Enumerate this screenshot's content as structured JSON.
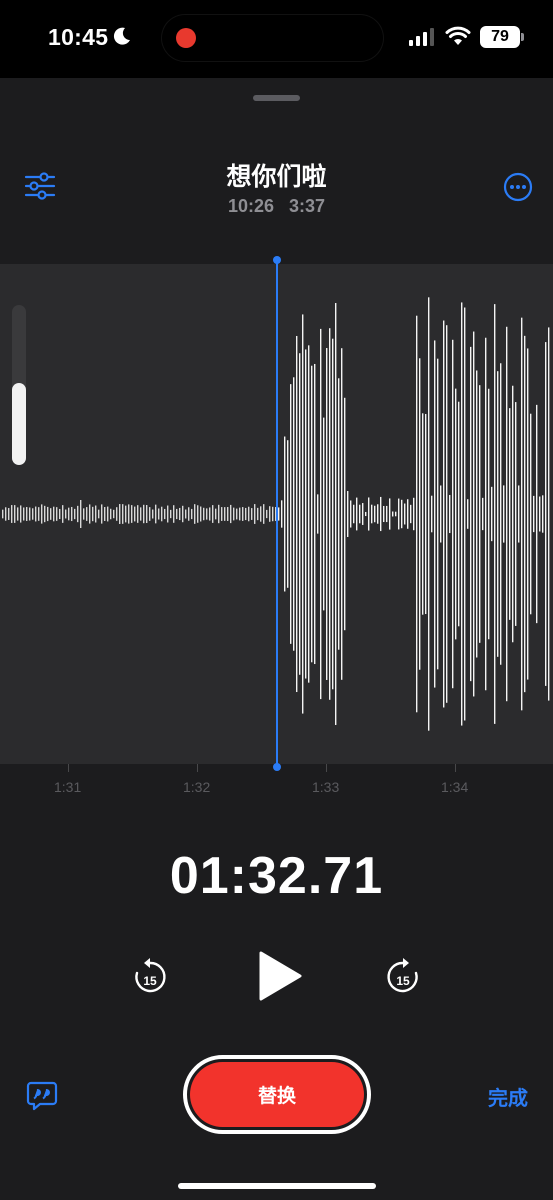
{
  "status_bar": {
    "time": "10:45",
    "focus_icon": "moon-icon",
    "recording_indicator": "red-dot",
    "battery": "79",
    "icons": [
      "cellular-signal-icon",
      "wifi-icon",
      "battery-icon"
    ]
  },
  "header": {
    "title": "想你们啦",
    "time_left": "10:26",
    "time_right": "3:37",
    "left_icon": "sliders-icon",
    "right_icon": "ellipsis-circle-icon"
  },
  "waveform": {
    "timeline_labels": [
      "1:31",
      "1:32",
      "1:33",
      "1:34"
    ],
    "playhead_color": "#2b7cf6"
  },
  "player": {
    "elapsed": "01:32.71",
    "skip_back_seconds": "15",
    "skip_forward_seconds": "15",
    "play_icon": "play-icon"
  },
  "footer": {
    "transcript_icon": "quote-bubble-icon",
    "replace_label": "替换",
    "done_label": "完成"
  },
  "colors": {
    "accent": "#2b7cf6",
    "record": "#f2332c",
    "background": "#1c1c1e",
    "waveform_bg": "#2b2b2d"
  }
}
